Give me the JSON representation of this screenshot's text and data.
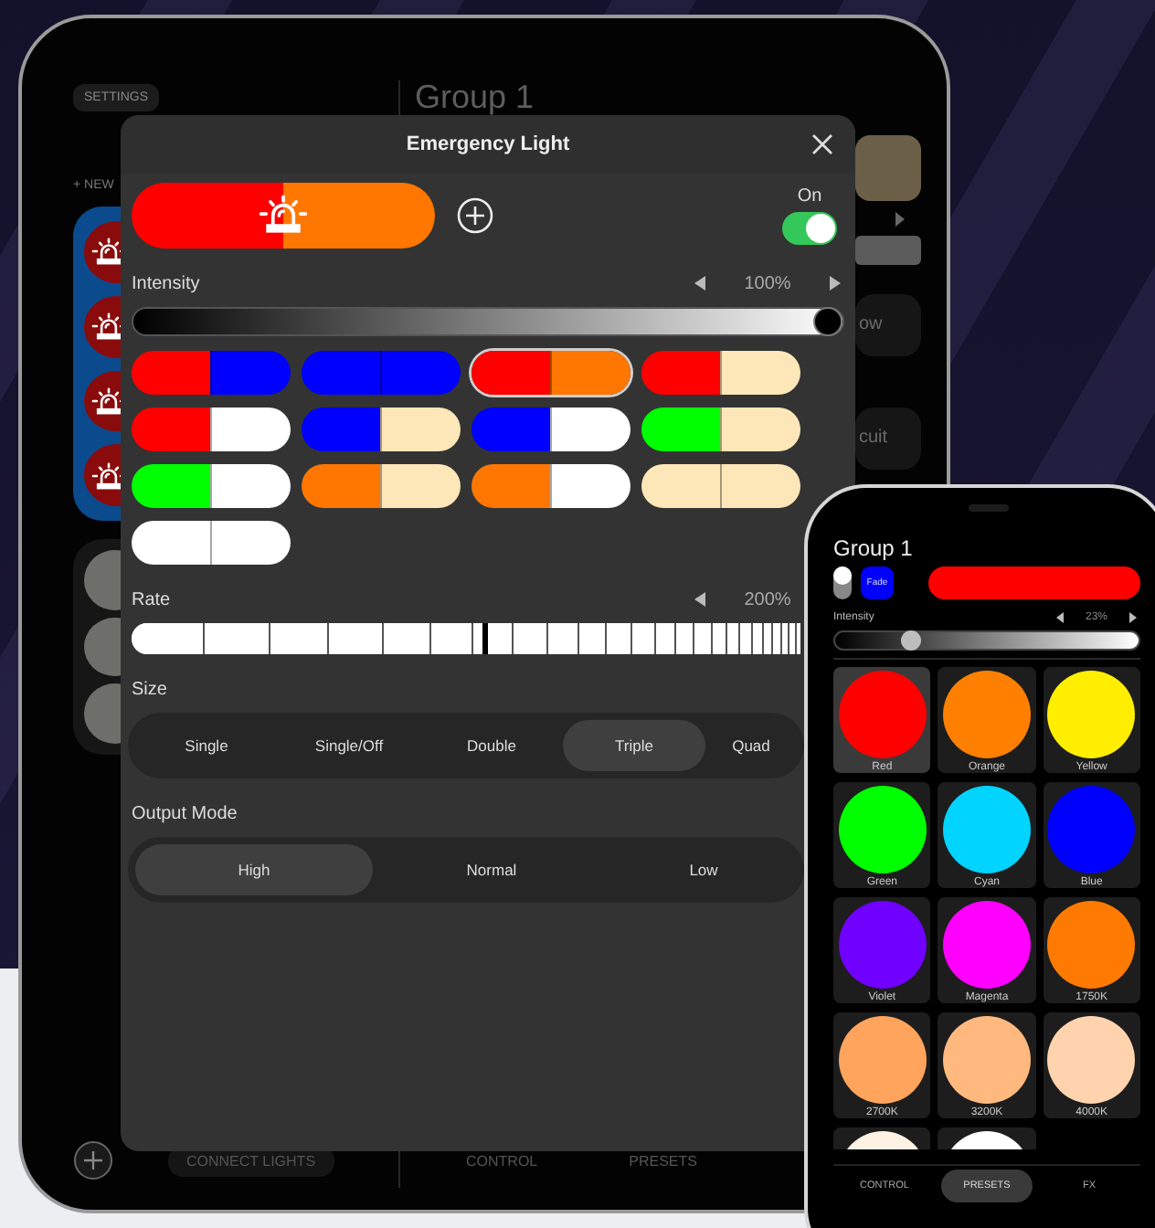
{
  "tablet": {
    "settings_button": "SETTINGS",
    "new_button": "+ NEW",
    "group_title": "Group 1",
    "side_cards": [
      {
        "label": "ow"
      },
      {
        "label": "cuit"
      }
    ],
    "connect_button": "CONNECT LIGHTS",
    "tabs": [
      {
        "label": "CONTROL"
      },
      {
        "label": "PRESETS"
      }
    ]
  },
  "dialog": {
    "title": "Emergency Light",
    "preview": [
      {
        "color": "#ff0000"
      },
      {
        "color": "#ff7700"
      }
    ],
    "power": {
      "label": "On",
      "on": true
    },
    "intensity": {
      "label": "Intensity",
      "reading": "100%",
      "level": 1
    },
    "presets": [
      {
        "halves": [
          {
            "color": "#ff0000"
          },
          {
            "color": "#0000ff"
          }
        ],
        "selected": false
      },
      {
        "halves": [
          {
            "color": "#0000ff"
          },
          {
            "color": "#0000ff"
          }
        ],
        "selected": false
      },
      {
        "halves": [
          {
            "color": "#ff0000"
          },
          {
            "color": "#ff7700"
          }
        ],
        "selected": true
      },
      {
        "halves": [
          {
            "color": "#ff0000"
          },
          {
            "color": "#fde6b8"
          }
        ],
        "selected": false
      },
      {
        "halves": [
          {
            "color": "#ff0000"
          },
          {
            "color": "#ffffff"
          }
        ],
        "selected": false
      },
      {
        "halves": [
          {
            "color": "#0000ff"
          },
          {
            "color": "#fde6b8"
          }
        ],
        "selected": false
      },
      {
        "halves": [
          {
            "color": "#0000ff"
          },
          {
            "color": "#ffffff"
          }
        ],
        "selected": false
      },
      {
        "halves": [
          {
            "color": "#00ff00"
          },
          {
            "color": "#fde6b8"
          }
        ],
        "selected": false
      },
      {
        "halves": [
          {
            "color": "#00ff00"
          },
          {
            "color": "#ffffff"
          }
        ],
        "selected": false
      },
      {
        "halves": [
          {
            "color": "#ff7700"
          },
          {
            "color": "#fde6b8"
          }
        ],
        "selected": false
      },
      {
        "halves": [
          {
            "color": "#ff7700"
          },
          {
            "color": "#ffffff"
          }
        ],
        "selected": false
      },
      {
        "halves": [
          {
            "color": "#fde6b8"
          },
          {
            "color": "#fde6b8"
          }
        ],
        "selected": false
      },
      {
        "halves": [
          {
            "color": "#ffffff"
          },
          {
            "color": "#ffffff"
          }
        ],
        "selected": false
      }
    ],
    "rate": {
      "label": "Rate",
      "reading": "200%",
      "level": 0.53
    },
    "size": {
      "label": "Size",
      "options": [
        {
          "label": "Single",
          "selected": false
        },
        {
          "label": "Single/Off",
          "selected": false
        },
        {
          "label": "Double",
          "selected": false
        },
        {
          "label": "Triple",
          "selected": true
        },
        {
          "label": "Quad",
          "selected": false
        }
      ]
    },
    "output_mode": {
      "label": "Output Mode",
      "options": [
        {
          "label": "High",
          "selected": true
        },
        {
          "label": "Normal",
          "selected": false
        },
        {
          "label": "Low",
          "selected": false
        }
      ]
    }
  },
  "phone": {
    "group_title": "Group 1",
    "fade_button": "Fade",
    "color_bar": {
      "color": "#ff0000"
    },
    "intensity": {
      "label": "Intensity",
      "reading": "23%",
      "level": 0.23
    },
    "presets": [
      {
        "label": "Red",
        "color": "#ff0000",
        "selected": true
      },
      {
        "label": "Orange",
        "color": "#ff8000",
        "selected": false
      },
      {
        "label": "Yellow",
        "color": "#ffee00",
        "selected": false
      },
      {
        "label": "Green",
        "color": "#00ff00",
        "selected": false
      },
      {
        "label": "Cyan",
        "color": "#00d4ff",
        "selected": false
      },
      {
        "label": "Blue",
        "color": "#0000ff",
        "selected": false
      },
      {
        "label": "Violet",
        "color": "#7000ff",
        "selected": false
      },
      {
        "label": "Magenta",
        "color": "#ff00ff",
        "selected": false
      },
      {
        "label": "1750K",
        "color": "#ff7a00",
        "selected": false
      },
      {
        "label": "2700K",
        "color": "#ffa45c",
        "selected": false
      },
      {
        "label": "3200K",
        "color": "#ffb97f",
        "selected": false
      },
      {
        "label": "4000K",
        "color": "#ffd3ad",
        "selected": false
      },
      {
        "color": "#fff2e4",
        "selected": false
      },
      {
        "color": "#ffffff",
        "selected": false
      }
    ],
    "tabs": [
      {
        "label": "CONTROL",
        "selected": false
      },
      {
        "label": "PRESETS",
        "selected": true
      },
      {
        "label": "FX",
        "selected": false
      }
    ]
  }
}
